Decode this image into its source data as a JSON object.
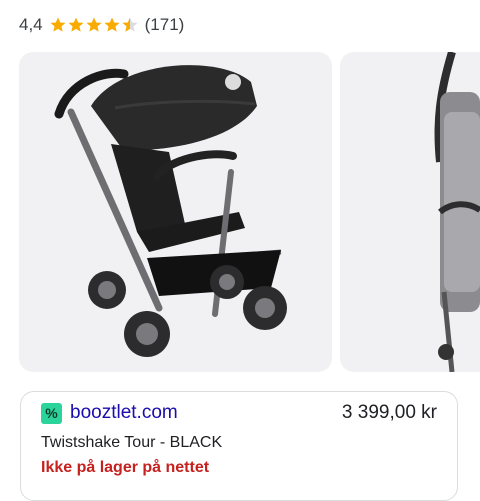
{
  "rating": {
    "value": "4,4",
    "stars": 4.4,
    "max_stars": 5,
    "review_count": "(171)",
    "star_color": "#f9ab00"
  },
  "images": [
    {
      "alt": "stroller-black-main"
    },
    {
      "alt": "stroller-grey-partial"
    }
  ],
  "offer": {
    "seller": "booztlet.com",
    "logo_glyph": "%",
    "logo_color": "#2bd49a",
    "price": "3 399,00 kr",
    "product": "Twistshake Tour - BLACK",
    "stock_status": "Ikke på lager på nettet",
    "stock_color": "#c5221f"
  }
}
